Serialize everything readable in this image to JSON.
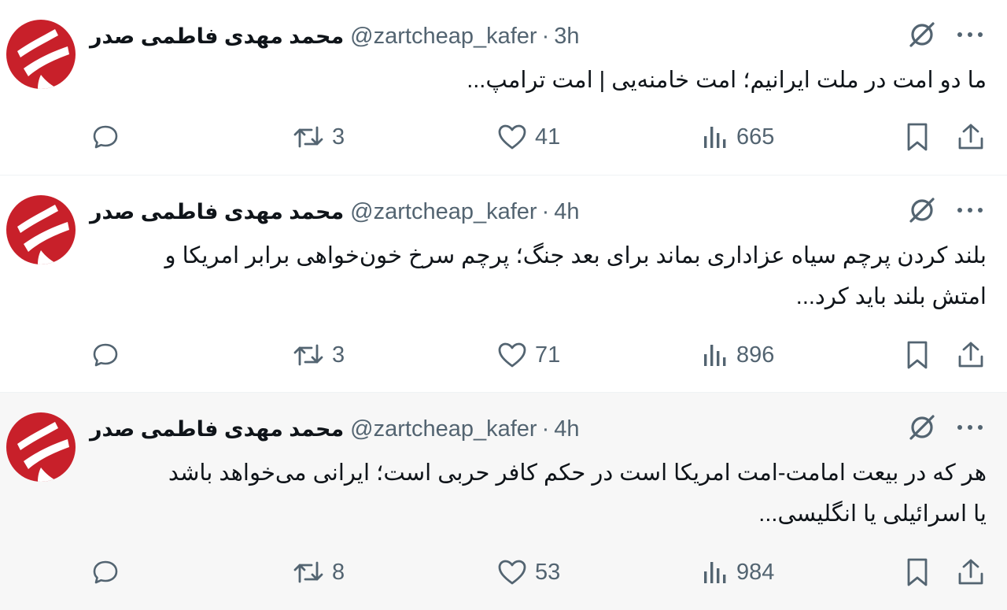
{
  "colors": {
    "icon_gray": "#536471",
    "text": "#0f1419",
    "avatar_red": "#c8202a",
    "highlight_bg": "#f7f7f7"
  },
  "tweets": [
    {
      "display_name": "محمد مهدی فاطمی صدر",
      "handle": "@zartcheap_kafer",
      "separator": "·",
      "time": "3h",
      "lines": [
        "ما دو امت در ملت ایرانیم؛ امت خامنه‌یی | امت ترامپ..."
      ],
      "retweets": "3",
      "likes": "41",
      "views": "665"
    },
    {
      "display_name": "محمد مهدی فاطمی صدر",
      "handle": "@zartcheap_kafer",
      "separator": "·",
      "time": "4h",
      "lines": [
        "بلند کردن پرچم سیاه عزاداری بماند برای بعد جنگ؛ پرچم سرخ خون‌خواهی برابر امریکا و",
        "امتش بلند باید کرد..."
      ],
      "retweets": "3",
      "likes": "71",
      "views": "896"
    },
    {
      "display_name": "محمد مهدی فاطمی صدر",
      "handle": "@zartcheap_kafer",
      "separator": "·",
      "time": "4h",
      "lines": [
        "هر که در بیعت امامت-امت امریکا است در حکم کافر حربی است؛ ایرانی می‌خواهد باشد",
        "یا اسرائیلی یا انگلیسی..."
      ],
      "retweets": "8",
      "likes": "53",
      "views": "984"
    }
  ]
}
